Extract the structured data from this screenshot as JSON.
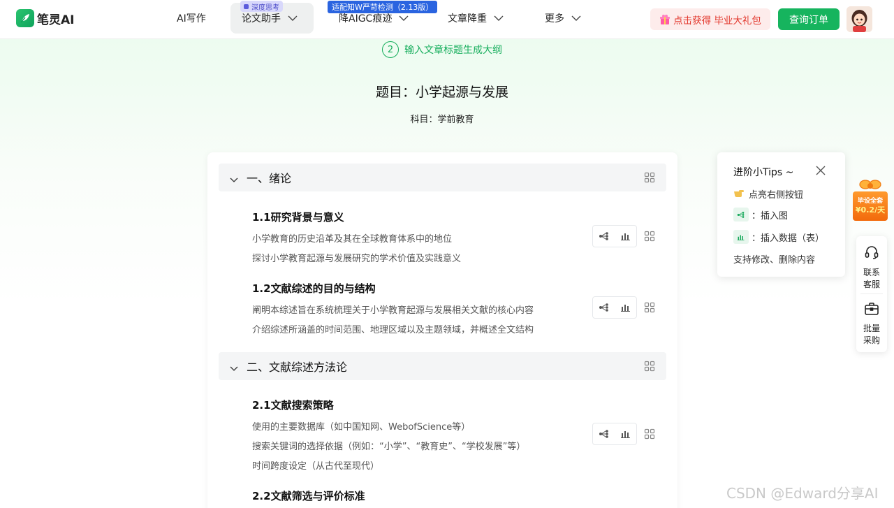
{
  "brand": {
    "name": "笔灵AI"
  },
  "nav": {
    "items": [
      {
        "label": "AI写作"
      },
      {
        "label": "论文助手",
        "badge": "深度思考"
      },
      {
        "label": "降AIGC痕迹",
        "badge": "适配知W严苛检测（2.13版）"
      },
      {
        "label": "文章降重"
      },
      {
        "label": "更多"
      }
    ],
    "gift_label": "点击获得 毕业大礼包",
    "order_label": "查询订单"
  },
  "step": {
    "number": "2",
    "label": "输入文章标题生成大纲"
  },
  "paper": {
    "title": "题目：小学起源与发展",
    "subject": "科目：学前教育"
  },
  "outline": {
    "chapters": [
      {
        "title": "一、绪论",
        "sections": [
          {
            "title": "1.1研究背景与意义",
            "lines": [
              "小学教育的历史沿革及其在全球教育体系中的地位",
              "探讨小学教育起源与发展研究的学术价值及实践意义"
            ]
          },
          {
            "title": "1.2文献综述的目的与结构",
            "lines": [
              "阐明本综述旨在系统梳理关于小学教育起源与发展相关文献的核心内容",
              "介绍综述所涵盖的时间范围、地理区域以及主题领域，并概述全文结构"
            ]
          }
        ]
      },
      {
        "title": "二、文献综述方法论",
        "sections": [
          {
            "title": "2.1文献搜索策略",
            "lines": [
              "使用的主要数据库（如中国知网、WebofScience等）",
              "搜索关键词的选择依据（例如：“小学”、“教育史”、“学校发展”等）",
              "时间跨度设定（从古代至现代）"
            ]
          },
          {
            "title": "2.2文献筛选与评价标准",
            "lines": []
          }
        ]
      }
    ]
  },
  "tips": {
    "title": "进阶小Tips ~",
    "line1": "点亮右侧按钮",
    "line2": "：插入图",
    "line3": "：插入数据（表）",
    "line4": "支持修改、删除内容"
  },
  "promo": {
    "line1": "毕设全套",
    "line2": "¥0.2/天"
  },
  "side": {
    "service_line1": "联系",
    "service_line2": "客服",
    "bulk_line1": "批量",
    "bulk_line2": "采购"
  },
  "watermark": "CSDN @Edward分享AI",
  "colors": {
    "accent": "#16b45e",
    "gift_text": "#e2352a",
    "badge_blue": "#2a64e0"
  }
}
